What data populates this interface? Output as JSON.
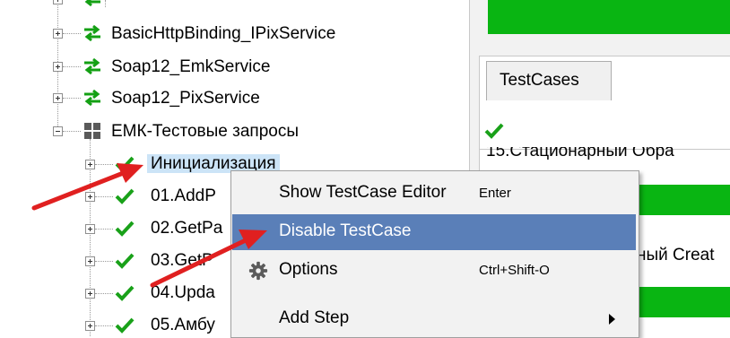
{
  "tree": {
    "items": [
      {
        "label": "BasicHttpBinding_IPixService"
      },
      {
        "label": "Soap12_EmkService"
      },
      {
        "label": "Soap12_PixService"
      },
      {
        "label": "ЕМК-Тестовые запросы"
      },
      {
        "label": "Инициализация"
      },
      {
        "label": "01.AddP"
      },
      {
        "label": "02.GetPa"
      },
      {
        "label": "03.GetP"
      },
      {
        "label": "04.Upda"
      },
      {
        "label": "05.Амбу"
      }
    ]
  },
  "right": {
    "tab_label": "TestCases",
    "partial_text_1": "15.Стационарный Обра",
    "partial_text_2": "ный Creat",
    "status_color": "#09b512"
  },
  "context_menu": {
    "items": [
      {
        "label": "Show TestCase Editor",
        "shortcut": "Enter"
      },
      {
        "label": "Disable TestCase",
        "shortcut": ""
      },
      {
        "label": "Options",
        "shortcut": "Ctrl+Shift-O"
      },
      {
        "label": "Add Step",
        "shortcut": ""
      }
    ],
    "highlight_color": "#5a7fb8"
  }
}
